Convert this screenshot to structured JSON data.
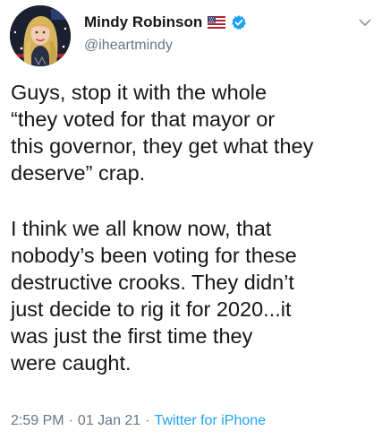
{
  "user": {
    "display_name": "Mindy Robinson",
    "handle": "@iheartmindy",
    "flag_icon": "us-flag-icon",
    "verified_icon": "verified-badge-icon",
    "verified_color": "#1da1f2"
  },
  "menu": {
    "icon": "chevron-down-icon"
  },
  "tweet": {
    "paragraphs": [
      {
        "lines": [
          "Guys, stop it with the whole",
          "“they voted for that mayor or",
          "this governor, they get what they",
          "deserve” crap."
        ]
      },
      {
        "lines": [
          "I think we all know now, that",
          "nobody’s been voting for these",
          "destructive crooks. They didn’t",
          "just decide to rig it for 2020...it",
          "was just the first time they",
          "were caught."
        ]
      }
    ]
  },
  "meta": {
    "time": "2:59 PM",
    "separator": "·",
    "date": "01 Jan 21",
    "source": "Twitter for iPhone",
    "source_color": "#1da1f2"
  }
}
